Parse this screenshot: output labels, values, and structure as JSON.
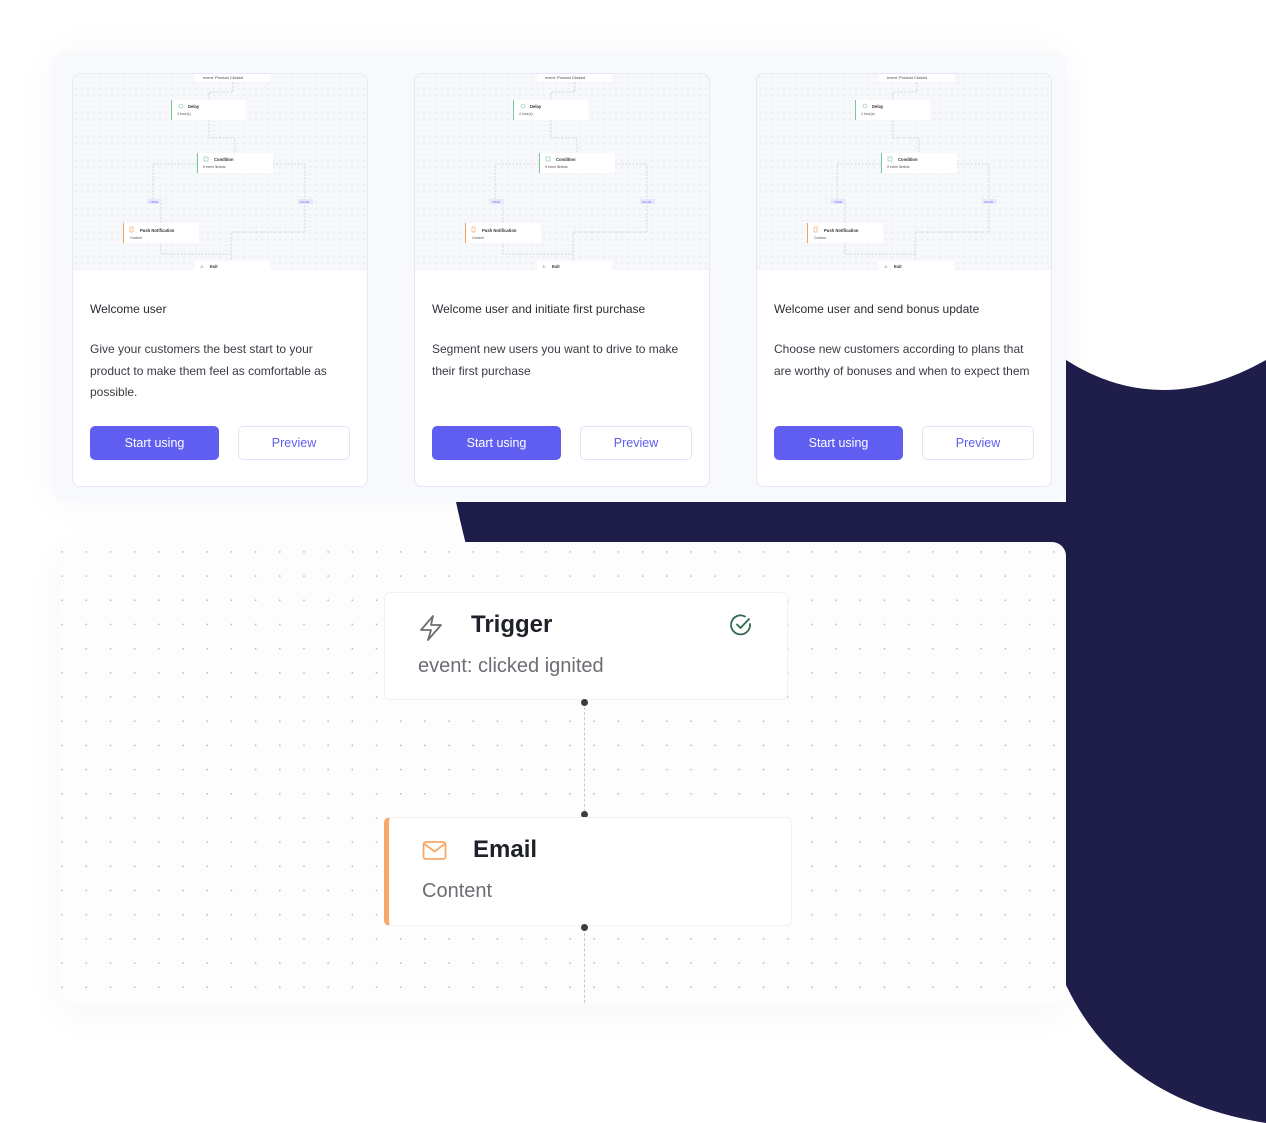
{
  "colors": {
    "accent": "#5f5ef0",
    "navy": "#1f1d4a",
    "delay_green": "#7cc49a",
    "push_orange": "#f0a060",
    "email_orange": "#f9a766",
    "trigger_check": "#2f6b4f"
  },
  "templates": [
    {
      "title": "Welcome user",
      "description": "Give your customers the best start to your product to make them feel as comfortable as possible.",
      "start_label": "Start using",
      "preview_label": "Preview",
      "diagram": {
        "trigger": "event: Product Clicked",
        "delay_title": "Delay",
        "delay_sub": "4 hour(s)",
        "condition_title": "Condition",
        "condition_sub": "If event $exists",
        "true_label": "TRUE",
        "false_label": "FALSE",
        "push_title": "Push Notification",
        "push_sub": "Content",
        "exit_title": "Exit"
      }
    },
    {
      "title": "Welcome user and initiate first purchase",
      "description": "Segment new users you want to drive to make their first purchase",
      "start_label": "Start using",
      "preview_label": "Preview",
      "diagram": {
        "trigger": "event: Product Clicked",
        "delay_title": "Delay",
        "delay_sub": "4 hour(s)",
        "condition_title": "Condition",
        "condition_sub": "If event $exists",
        "true_label": "TRUE",
        "false_label": "FALSE",
        "push_title": "Push Notification",
        "push_sub": "Content",
        "exit_title": "Exit"
      }
    },
    {
      "title": "Welcome user and send bonus update",
      "description": "Choose new customers according to plans that are worthy of bonuses and when to expect them",
      "start_label": "Start using",
      "preview_label": "Preview",
      "diagram": {
        "trigger": "event: Product Clicked",
        "delay_title": "Delay",
        "delay_sub": "4 hour(s)",
        "condition_title": "Condition",
        "condition_sub": "If event $exists",
        "true_label": "TRUE",
        "false_label": "FALSE",
        "push_title": "Push Notification",
        "push_sub": "Content",
        "exit_title": "Exit"
      }
    }
  ],
  "flow": {
    "trigger": {
      "icon": "lightning-icon",
      "title": "Trigger",
      "subtitle": "event: clicked ignited",
      "status_icon": "check-circle-icon"
    },
    "email": {
      "icon": "envelope-icon",
      "title": "Email",
      "subtitle": "Content"
    }
  }
}
